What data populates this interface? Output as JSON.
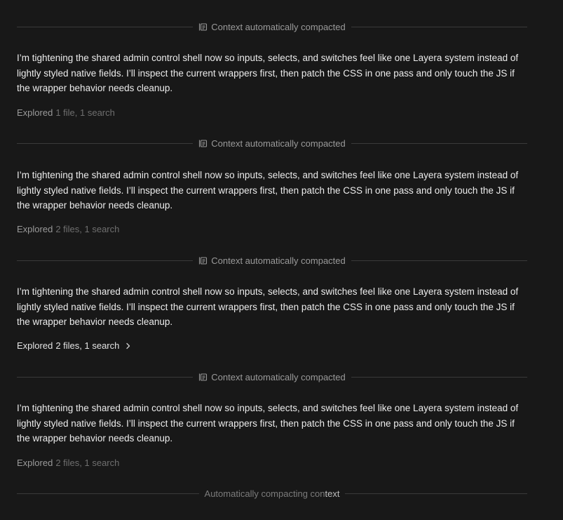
{
  "compacted_label": "Context automatically compacted",
  "message_text": "I’m tightening the shared admin control shell now so inputs, selects, and switches feel like one Layera system instead of lightly styled native fields. I’ll inspect the current wrappers first, then patch the CSS in one pass and only touch the JS if the wrapper behavior needs cleanup.",
  "blocks": [
    {
      "explored_verb": "Explored",
      "explored_detail": "1 file, 1 search"
    },
    {
      "explored_verb": "Explored",
      "explored_detail": "2 files, 1 search"
    },
    {
      "explored_verb": "Explored",
      "explored_detail": "2 files, 1 search",
      "expanded_hint": "chevron-right"
    },
    {
      "explored_verb": "Explored",
      "explored_detail": "2 files, 1 search"
    }
  ],
  "pending": {
    "label_dim": "Automatically compacting con",
    "label_highlight": "text"
  },
  "icons": {
    "compact": "compact-icon",
    "chevron": "chevron-right-icon"
  },
  "colors": {
    "background": "#181818",
    "text": "#ececec",
    "muted": "#9a9a9a",
    "divider": "#3a3a3a"
  }
}
